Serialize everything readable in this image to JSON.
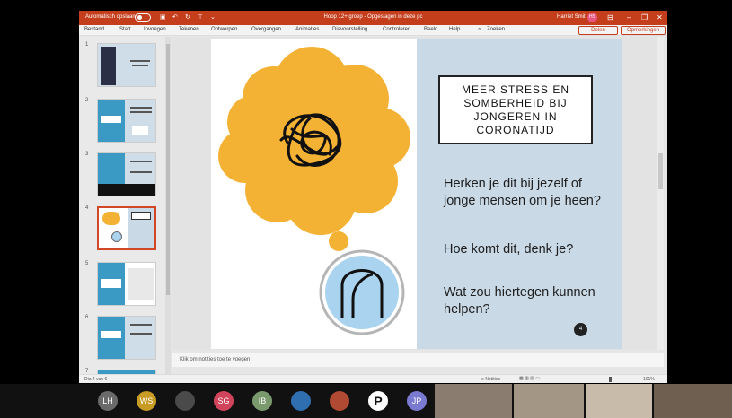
{
  "titlebar": {
    "autosave_label": "Automatisch opslaan",
    "doc_title": "Hoop 12+ groep - Opgeslagen in deze pc",
    "user_name": "Harriet Smit",
    "user_initials": "HS"
  },
  "menu": [
    "Bestand",
    "Start",
    "Invoegen",
    "Tekenen",
    "Ontwerpen",
    "Overgangen",
    "Animaties",
    "Diavoorstelling",
    "Controleren",
    "Beeld",
    "Help",
    "Zoeken"
  ],
  "share_label": "Delen",
  "comments_label": "Opmerkingen",
  "thumbnails": {
    "numbers": [
      "1",
      "2",
      "3",
      "4",
      "5",
      "6",
      "7"
    ],
    "selected": 4
  },
  "slide": {
    "title": "MEER STRESS EN SOMBERHEID BIJ JONGEREN IN CORONATIJD",
    "questions": [
      "Herken je dit bij jezelf of jonge mensen om je heen?",
      "Hoe komt dit, denk je?",
      "Wat zou hiertegen kunnen helpen?"
    ],
    "page_number": "4",
    "colors": {
      "cloud": "#f4b234",
      "panel": "#c9d9e6",
      "circle": "#a9d3ee"
    }
  },
  "notes_placeholder": "Klik om notities toe te voegen",
  "status": {
    "slide_count": "Dia 4 van 6",
    "notes_label": "Notities",
    "zoom": "101%"
  },
  "participants": [
    {
      "initials": "LH",
      "color": "#6a6a6a"
    },
    {
      "initials": "WS",
      "color": "#c79b24"
    },
    {
      "initials": "",
      "color": "#4a4a4a"
    },
    {
      "initials": "SG",
      "color": "#d2445b"
    },
    {
      "initials": "IB",
      "color": "#7a9a6e"
    },
    {
      "initials": "",
      "color": "#2f6fb0"
    },
    {
      "initials": "",
      "color": "#b14a33"
    },
    {
      "initials": "P",
      "color": "#ffffff"
    },
    {
      "initials": "JP",
      "color": "#7a7ad0"
    }
  ]
}
